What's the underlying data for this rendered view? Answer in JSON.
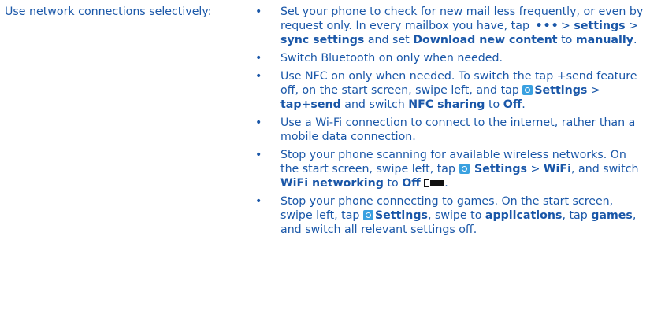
{
  "lead_label": "Use network connections selectively:",
  "bullets": [
    {
      "p1": "Set your phone to check for new mail less frequently, or even by request only. In every mailbox you have, tap",
      "p2": ">",
      "b1": "settings",
      "p3": ">",
      "b2": "sync settings",
      "p4": "and set",
      "b3": "Download new content",
      "p5": "to",
      "b4": "manually",
      "p6": "."
    },
    {
      "text": "Switch Bluetooth on only when needed."
    },
    {
      "p1": "Use NFC on only when needed. To switch the tap +send feature off, on the start screen, swipe left, and tap",
      "b1": "Settings",
      "p2": ">",
      "b2": "tap+send",
      "p3": "and switch",
      "b3": "NFC sharing",
      "p4": "to",
      "b4": "Off",
      "p5": "."
    },
    {
      "text": "Use a Wi-Fi connection to connect to the internet, rather than a mobile data connection."
    },
    {
      "p1": "Stop your phone scanning for available wireless networks. On the start screen, swipe left, tap",
      "b1": "Settings",
      "p2": ">",
      "b2": "WiFi",
      "p3": ", and switch",
      "b3": "WiFi networking",
      "p4": "to",
      "b4": "Off",
      "p5": "."
    },
    {
      "p1": "Stop your phone connecting to games. On the start screen, swipe left, tap",
      "b1": "Settings",
      "p2": ", swipe to",
      "b2": "applications",
      "p3": ", tap",
      "b3": "games",
      "p4": ", and switch all relevant settings off."
    }
  ],
  "icons": {
    "more": "ellipsis-icon",
    "settings": "gear-icon",
    "toggle": "toggle-off-icon"
  },
  "colors": {
    "text": "#1a57a8",
    "settings_icon": "#3aa1e0"
  }
}
